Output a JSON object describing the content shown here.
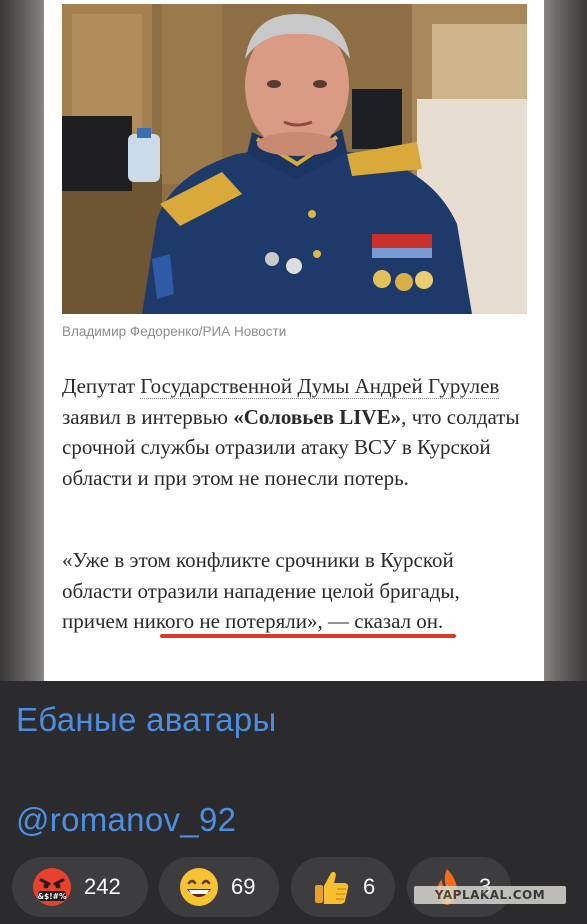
{
  "article": {
    "photo_alt": "",
    "caption": "Владимир Федоренко/РИА Новости",
    "p1_t1": "Депутат ",
    "p1_link": "Государственной Думы Андрей Гурулев",
    "p1_t2": " заявил в интервью ",
    "p1_bold": "«Соловьев LIVE»",
    "p1_t3": ", что солдаты срочной службы отразили атаку ВСУ в Курской области и при этом не понесли потерь.",
    "p2_t1": "«Уже в этом конфликте срочники в Курской области отразили нападение целой бригады, ",
    "p2_highlight": "причем никого не потеряли",
    "p2_t2": "», — сказал он."
  },
  "message": {
    "line1": "Ебаные аватары",
    "line2": "@romanov_92"
  },
  "reactions": [
    {
      "emoji": "angry-cursing-face",
      "count": "242"
    },
    {
      "emoji": "grinning-face",
      "count": "69"
    },
    {
      "emoji": "thumbs-up",
      "count": "6"
    },
    {
      "emoji": "fire",
      "count": "3"
    }
  ],
  "watermark": "YAPLAKAL.COM",
  "colors": {
    "accent_text": "#4d8ee0",
    "highlight_underline": "#d9392b",
    "dark_bg": "#2b2a2c",
    "reaction_bg": "#3d3c3f"
  }
}
